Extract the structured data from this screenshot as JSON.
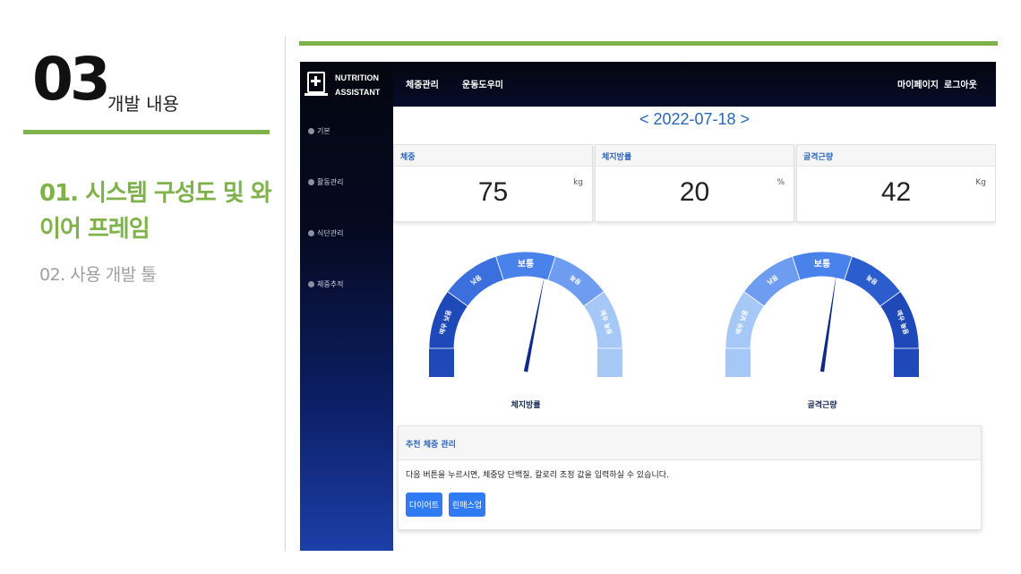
{
  "slide": {
    "section_number": "03",
    "section_title": "개발 내용",
    "items": [
      {
        "label": "01. 시스템 구성도 및 와이어 프레임",
        "active": true
      },
      {
        "label": "02. 사용 개발 툴",
        "active": false
      }
    ],
    "accent_color": "#7fb24a"
  },
  "app": {
    "brand": {
      "line1": "NUTRITION",
      "line2": "ASSISTANT"
    },
    "nav_left": [
      "체중관리",
      "운동도우미"
    ],
    "nav_right": [
      "마이페이지",
      "로그아웃"
    ],
    "sidebar": [
      {
        "label": "기본"
      },
      {
        "label": "활동관리"
      },
      {
        "label": "식단관리"
      },
      {
        "label": "체중추적"
      }
    ],
    "date_display": "< 2022-07-18 >",
    "cards": [
      {
        "title": "체중",
        "value": "75",
        "unit": "kg"
      },
      {
        "title": "체지방률",
        "value": "20",
        "unit": "%"
      },
      {
        "title": "골격근량",
        "value": "42",
        "unit": "Kg"
      }
    ],
    "gauges": [
      {
        "caption": "체지방률",
        "segments": [
          "매우 낮음",
          "낮음",
          "보통",
          "높음",
          "매우 높음"
        ],
        "colors": [
          "#1f48b8",
          "#3a6fdd",
          "#4a82ec",
          "#6e9cf0",
          "#a6c8f7"
        ],
        "needle_fraction": 0.58
      },
      {
        "caption": "골격근량",
        "segments": [
          "매우 낮음",
          "낮음",
          "보통",
          "높음",
          "매우 높음"
        ],
        "colors": [
          "#a6c8f7",
          "#6e9cf0",
          "#4a82ec",
          "#2c5dcf",
          "#1f48b8"
        ],
        "needle_fraction": 0.56
      }
    ],
    "recommend": {
      "title": "추천 체중 관리",
      "description": "다음 버튼을 누르시면, 체중당 단백질, 칼로리 조정 값을 입력하실 수 있습니다.",
      "buttons": [
        "다이어트",
        "린매스업"
      ]
    }
  }
}
